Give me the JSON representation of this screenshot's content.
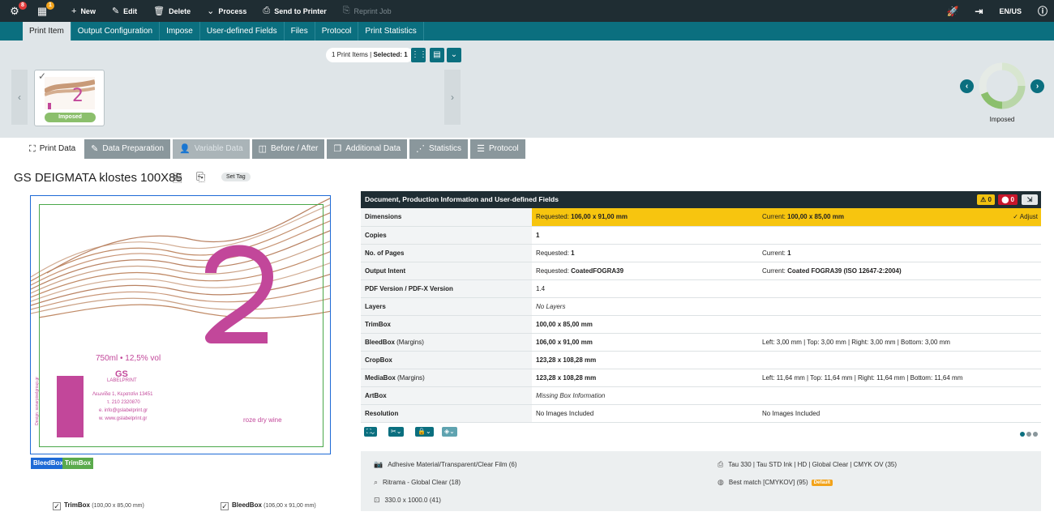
{
  "topbar": {
    "badge_1": "8",
    "badge_2": "1",
    "cmds": [
      "New",
      "Edit",
      "Delete",
      "Process",
      "Send to Printer",
      "Reprint Job"
    ],
    "lang": "EN/US"
  },
  "tabs": [
    "Print Item",
    "Output Configuration",
    "Impose",
    "User-defined Fields",
    "Files",
    "Protocol",
    "Print Statistics"
  ],
  "carousel": {
    "selection_prefix": "1 Print Items | ",
    "selection_bold": "Selected: 1",
    "item_status": "Imposed",
    "donut_label": "Imposed"
  },
  "subtabs": [
    "Print Data",
    "Data Preparation",
    "Variable Data",
    "Before / After",
    "Additional Data",
    "Statistics",
    "Protocol"
  ],
  "heading": {
    "title": "GS DEIGMATA klostes 100X85",
    "set_tag": "Set Tag"
  },
  "preview": {
    "volume": "750ml • 12,5% vol",
    "brand": "GS",
    "brand_sub": "LABELPRINT",
    "addr1": "Λεωνίδα 1, Κερατσίνι 13451",
    "addr2": "τ. 210 2320870",
    "addr3": "e. info@gslabelprint.gr",
    "addr4": "w. www.gslabelprint.gr",
    "wine": "roze dry wine",
    "design": "Design: sonarpixelgroup.gr",
    "bleed_label": "BleedBox",
    "trim_label": "TrimBox",
    "check_trim": "TrimBox",
    "check_trim_size": "(100,00 x 85,00 mm)",
    "check_bleed": "BleedBox",
    "check_bleed_size": "(106,00 x 91,00 mm)"
  },
  "panel": {
    "title": "Document, Production Information and User-defined Fields",
    "warn_count": "0",
    "err_count": "0",
    "adjust": "Adjust",
    "rows": [
      {
        "k": "Dimensions",
        "c1a": "Requested: ",
        "c1b": "106,00 x 91,00 mm",
        "c2a": "Current: ",
        "c2b": "100,00 x 85,00 mm"
      },
      {
        "k": "Copies",
        "c1b": "1"
      },
      {
        "k": "No. of Pages",
        "c1a": "Requested: ",
        "c1b": "1",
        "c2a": "Current: ",
        "c2b": "1"
      },
      {
        "k": "Output Intent",
        "c1a": "Requested: ",
        "c1b": "CoatedFOGRA39",
        "c2a": "Current: ",
        "c2b": "Coated FOGRA39 (ISO 12647-2:2004)"
      },
      {
        "k": "PDF Version / PDF-X Version",
        "c1a": "1.4"
      },
      {
        "k": "Layers",
        "c1i": "No Layers"
      },
      {
        "k": "TrimBox",
        "c1b": "100,00 x 85,00 mm"
      },
      {
        "k": "BleedBox",
        "km": " (Margins)",
        "c1b": "106,00 x 91,00 mm",
        "c2a": "Left: 3,00 mm | Top: 3,00 mm | Right: 3,00 mm | Bottom: 3,00 mm"
      },
      {
        "k": "CropBox",
        "c1b": "123,28 x 108,28 mm"
      },
      {
        "k": "MediaBox",
        "km": " (Margins)",
        "c1b": "123,28 x 108,28 mm",
        "c2a": "Left: 11,64 mm | Top: 11,64 mm | Right: 11,64 mm | Bottom: 11,64 mm"
      },
      {
        "k": "ArtBox",
        "c1i": "Missing Box Information"
      },
      {
        "k": "Resolution",
        "c1a": "No Images Included",
        "c2a": "No Images Included"
      }
    ]
  },
  "bottom": {
    "material": "Adhesive Material/Transparent/Clear Film (6)",
    "ritrama": "Ritrama - Global Clear (18)",
    "size": "330.0 x 1000.0 (41)",
    "ink": "Tau 330 | Tau STD Ink | HD | Global Clear | CMYK OV (35)",
    "match": "Best match [CMYKOV] (95)",
    "default_tag": "Default"
  },
  "colors": {
    "accent": "#0b6f7f",
    "dark": "#1f2d33",
    "highlight": "#f7c50f",
    "bleed": "#1e6ad6",
    "trim": "#4aa84a",
    "magenta": "#c2479a"
  }
}
